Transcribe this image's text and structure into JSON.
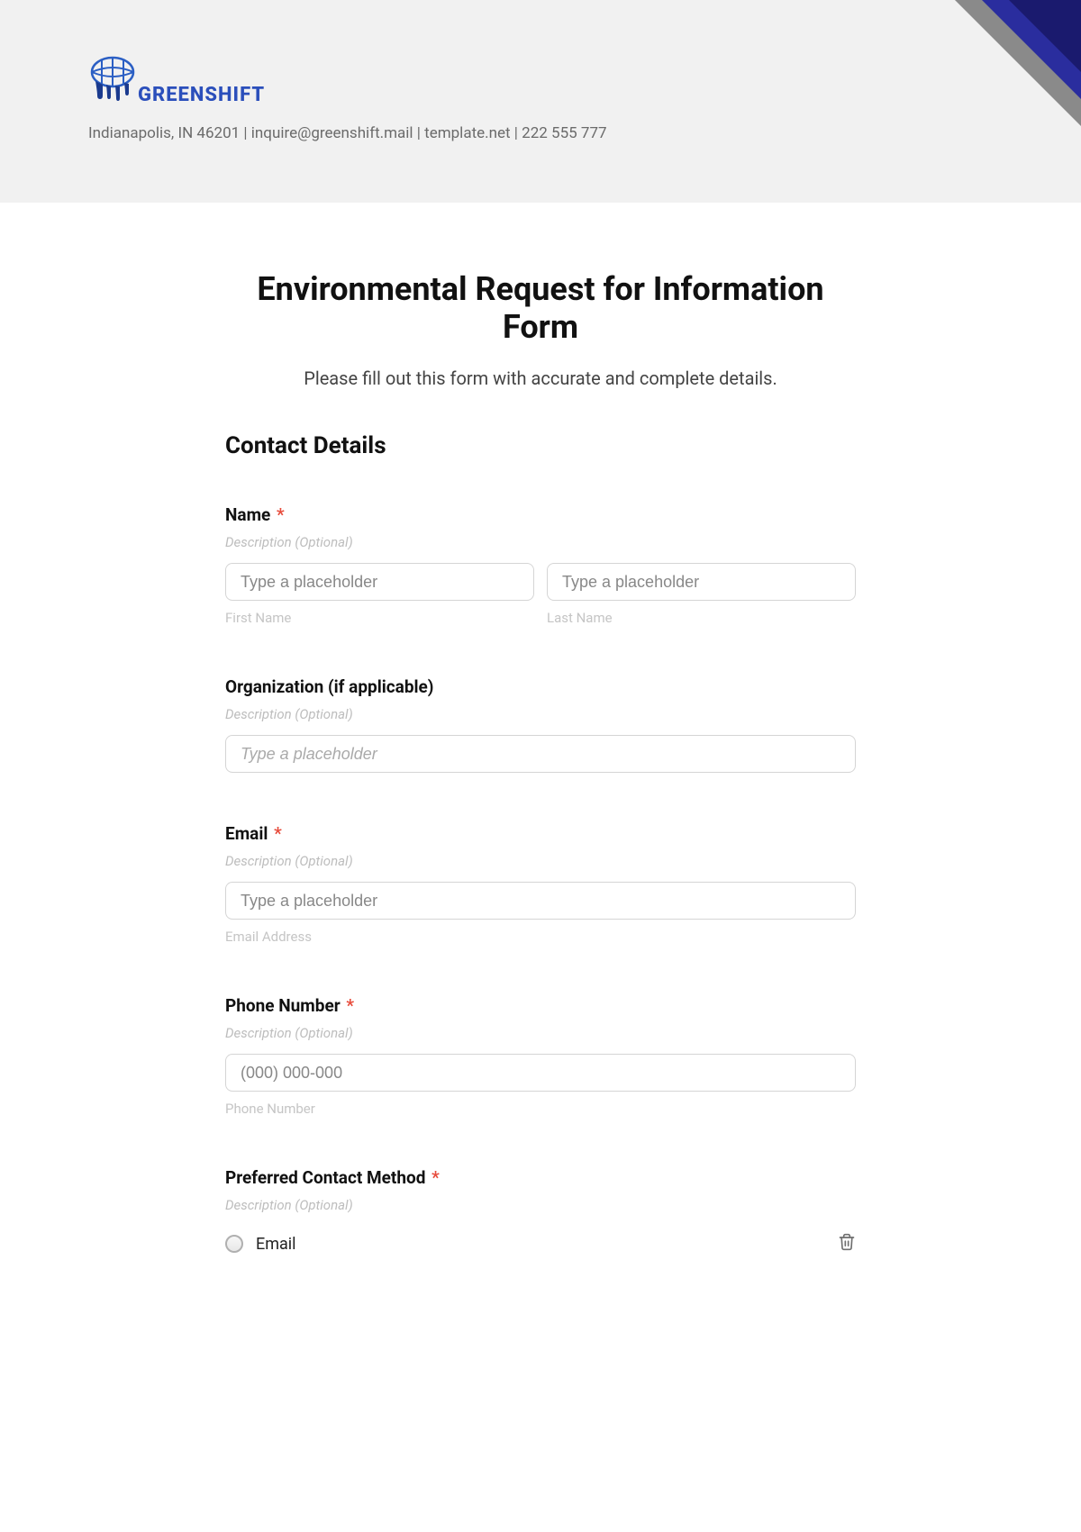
{
  "header": {
    "brand_name": "GREENSHIFT",
    "contact_line": "Indianapolis, IN 46201 | inquire@greenshift.mail | template.net | 222 555 777"
  },
  "form": {
    "title": "Environmental Request for Information Form",
    "subtitle": "Please fill out this form with accurate and complete details.",
    "section_contact": "Contact Details",
    "fields": {
      "name": {
        "label": "Name",
        "required": true,
        "description": "Description (Optional)",
        "first_placeholder": "Type a placeholder",
        "first_sublabel": "First Name",
        "last_placeholder": "Type a placeholder",
        "last_sublabel": "Last Name"
      },
      "organization": {
        "label": "Organization (if applicable)",
        "required": false,
        "description": "Description (Optional)",
        "placeholder": "Type a placeholder"
      },
      "email": {
        "label": "Email",
        "required": true,
        "description": "Description (Optional)",
        "placeholder": "Type a placeholder",
        "sublabel": "Email Address"
      },
      "phone": {
        "label": "Phone Number",
        "required": true,
        "description": "Description (Optional)",
        "placeholder": "(000) 000-000",
        "sublabel": "Phone Number"
      },
      "preferred": {
        "label": "Preferred Contact Method",
        "required": true,
        "description": "Description (Optional)",
        "options": [
          "Email"
        ]
      }
    },
    "required_marker": "*"
  }
}
